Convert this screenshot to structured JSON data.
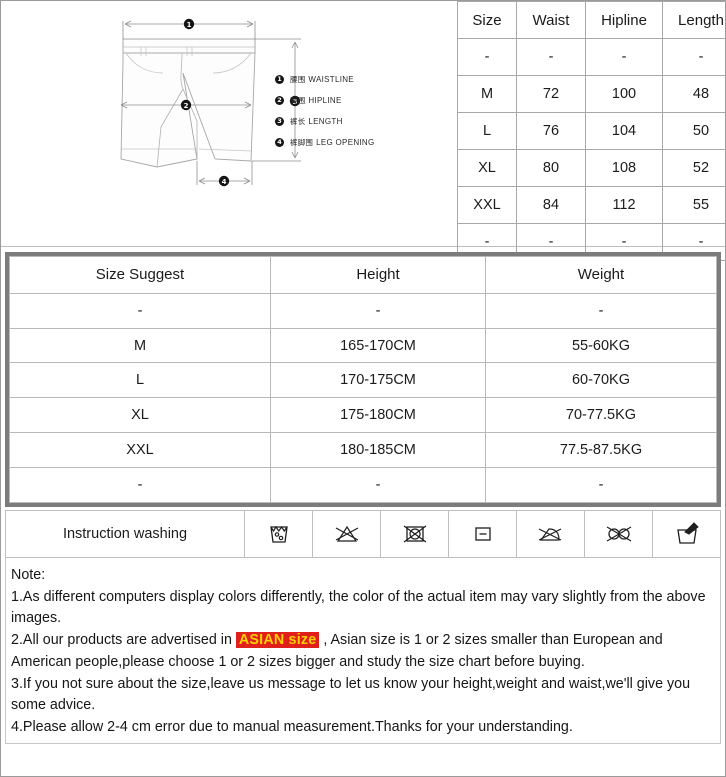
{
  "diagram": {
    "legend": [
      {
        "num": "1",
        "cn": "腰围",
        "en": "WAISTLINE"
      },
      {
        "num": "2",
        "cn": "臀围",
        "en": "HIPLINE"
      },
      {
        "num": "3",
        "cn": "裤长",
        "en": "LENGTH"
      },
      {
        "num": "4",
        "cn": "裤脚围",
        "en": "LEG OPENING"
      }
    ],
    "markers": {
      "m1": "1",
      "m2": "2",
      "m3": "3",
      "m4": "4"
    }
  },
  "size_table": {
    "headers": [
      "Size",
      "Waist",
      "Hipline",
      "Length"
    ],
    "rows": [
      [
        "-",
        "-",
        "-",
        "-"
      ],
      [
        "M",
        "72",
        "100",
        "48"
      ],
      [
        "L",
        "76",
        "104",
        "50"
      ],
      [
        "XL",
        "80",
        "108",
        "52"
      ],
      [
        "XXL",
        "84",
        "112",
        "55"
      ],
      [
        "-",
        "-",
        "-",
        "-"
      ]
    ]
  },
  "suggest_table": {
    "headers": [
      "Size Suggest",
      "Height",
      "Weight"
    ],
    "rows": [
      [
        "-",
        "-",
        "-"
      ],
      [
        "M",
        "165-170CM",
        "55-60KG"
      ],
      [
        "L",
        "170-175CM",
        "60-70KG"
      ],
      [
        "XL",
        "175-180CM",
        "70-77.5KG"
      ],
      [
        "XXL",
        "180-185CM",
        "77.5-87.5KG"
      ],
      [
        "-",
        "-",
        "-"
      ]
    ]
  },
  "washing": {
    "label": "Instruction washing",
    "icons": [
      "machine-wash-icon",
      "do-not-bleach-icon",
      "do-not-tumble-dry-icon",
      "dry-flat-icon",
      "do-not-iron-icon",
      "do-not-dry-clean-icon",
      "hand-wash-icon"
    ]
  },
  "note": {
    "title": "Note:",
    "line1": "1.As different computers display colors differently, the color of the actual item may vary slightly from the above images.",
    "line2_pre": "2.All our products are advertised in ",
    "line2_hl": "ASIAN size",
    "line2_post": " , Asian size is 1 or 2 sizes smaller than European and",
    "line3": "American people,please choose 1 or 2 sizes bigger and study the size chart before buying.",
    "line4": "3.If you not sure about the size,leave us message to let us know your height,weight and waist,we'll give you some advice.",
    "line5": "4.Please allow 2-4 cm error due to manual measurement.Thanks for your understanding."
  },
  "colors": {
    "highlight_bg": "#e0201b",
    "highlight_fg": "#ffd000",
    "frame": "#7c7c7c",
    "grid": "#b9b9b9"
  }
}
